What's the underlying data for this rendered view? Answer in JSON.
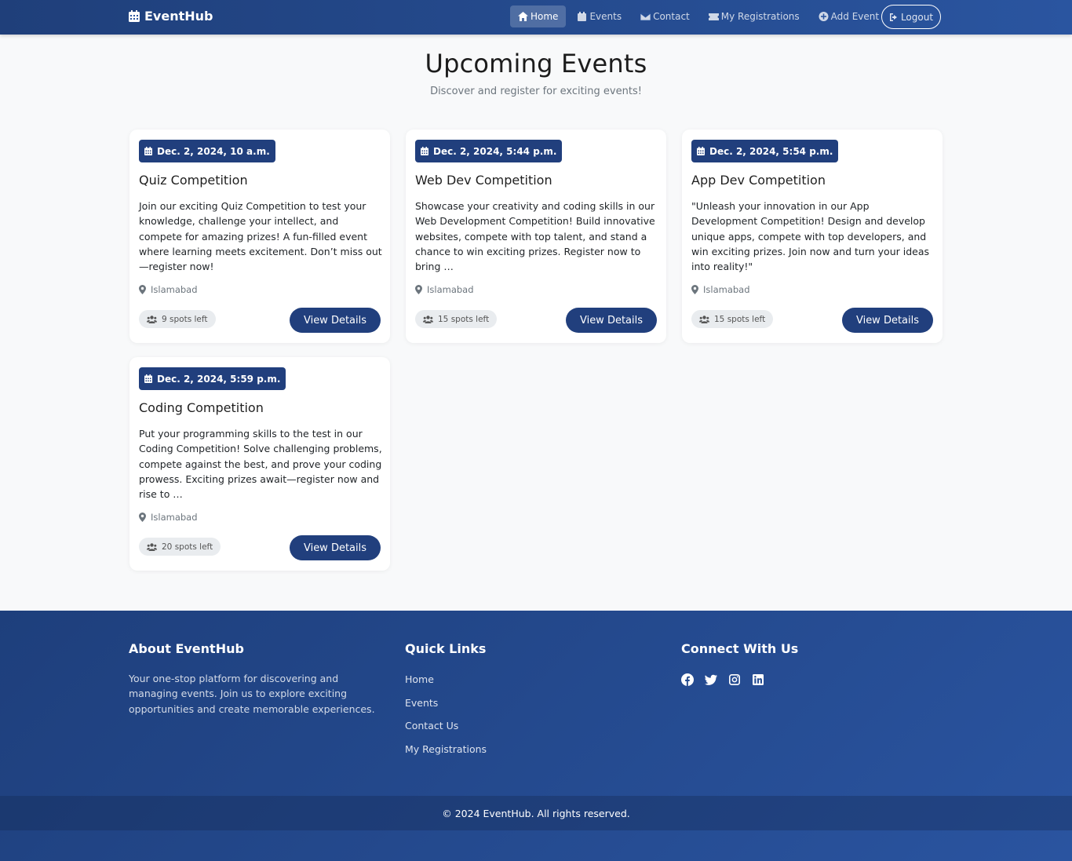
{
  "nav": {
    "brand": "EventHub",
    "links": [
      {
        "label": "Home",
        "active": true
      },
      {
        "label": "Events"
      },
      {
        "label": "Contact"
      },
      {
        "label": "My Registrations"
      },
      {
        "label": "Add Event"
      }
    ],
    "logout": "Logout"
  },
  "header": {
    "title": "Upcoming Events",
    "subtitle": "Discover and register for exciting events!"
  },
  "events": [
    {
      "date": "Dec. 2, 2024, 10 a.m.",
      "title": "Quiz Competition",
      "description": "Join our exciting Quiz Competition to test your knowledge, challenge your intellect, and compete for amazing prizes! A fun-filled event where learning meets excitement. Don’t miss out—register now!",
      "location": "Islamabad",
      "spots": "9 spots left",
      "button": "View Details"
    },
    {
      "date": "Dec. 2, 2024, 5:44 p.m.",
      "title": "Web Dev Competition",
      "description": "Showcase your creativity and coding skills in our Web Development Competition! Build innovative websites, compete with top talent, and stand a chance to win exciting prizes. Register now to bring …",
      "location": "Islamabad",
      "spots": "15 spots left",
      "button": "View Details"
    },
    {
      "date": "Dec. 2, 2024, 5:54 p.m.",
      "title": "App Dev Competition",
      "description": "\"Unleash your innovation in our App Development Competition! Design and develop unique apps, compete with top developers, and win exciting prizes. Join now and turn your ideas into reality!\"",
      "location": "Islamabad",
      "spots": "15 spots left",
      "button": "View Details"
    },
    {
      "date": "Dec. 2, 2024, 5:59 p.m.",
      "title": "Coding Competition",
      "description": "Put your programming skills to the test in our Coding Competition! Solve challenging problems, compete against the best, and prove your coding prowess. Exciting prizes await—register now and rise to …",
      "location": "Islamabad",
      "spots": "20 spots left",
      "button": "View Details"
    }
  ],
  "footer": {
    "about_title": "About EventHub",
    "about_text": "Your one-stop platform for discovering and managing events. Join us to explore exciting opportunities and create memorable experiences.",
    "links_title": "Quick Links",
    "links": [
      "Home",
      "Events",
      "Contact Us",
      "My Registrations"
    ],
    "connect_title": "Connect With Us",
    "social": [
      "facebook-icon",
      "twitter-icon",
      "instagram-icon",
      "linkedin-icon"
    ],
    "copyright": "© 2024 EventHub. All rights reserved."
  }
}
